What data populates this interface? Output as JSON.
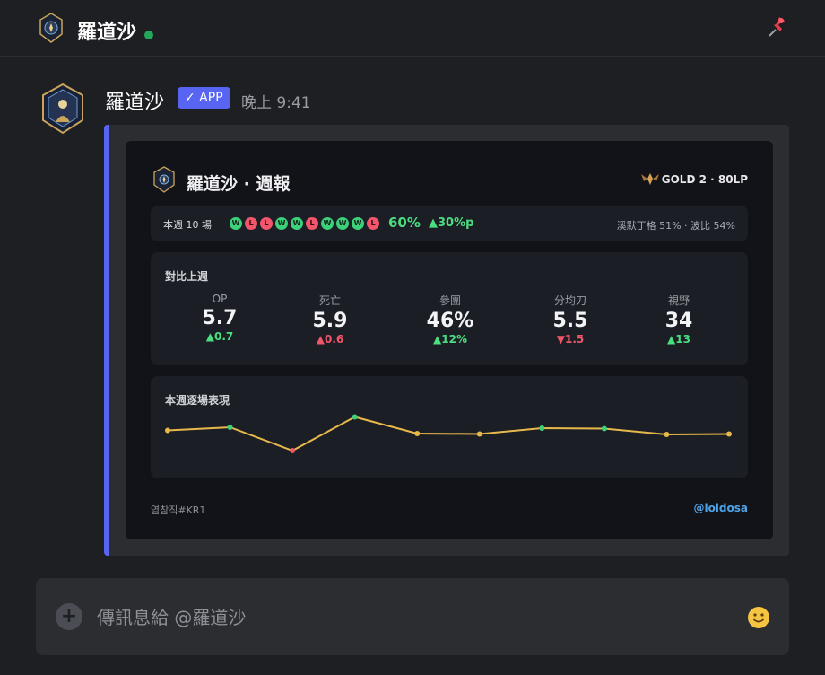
{
  "header": {
    "channel_name": "羅道沙",
    "status": "online"
  },
  "message": {
    "author": "羅道沙",
    "badge": "✓ APP",
    "time": "晚上 9:41"
  },
  "card": {
    "title": "羅道沙 · 週報",
    "rank": "GOLD 2 · 80LP",
    "week": {
      "label": "本週 10 場",
      "results": [
        "W",
        "L",
        "L",
        "W",
        "W",
        "L",
        "W",
        "W",
        "W",
        "L"
      ],
      "winrate": "60%",
      "winrate_delta": "▲30%p",
      "champions": "溪默丁格 51% · 波比 54%"
    },
    "comparison": {
      "title": "對比上週",
      "stats": [
        {
          "label": "OP",
          "value": "5.7",
          "delta": "▲0.7",
          "direction": "up"
        },
        {
          "label": "死亡",
          "value": "5.9",
          "delta": "▲0.6",
          "direction": "down"
        },
        {
          "label": "參團",
          "value": "46%",
          "delta": "▲12%",
          "direction": "up"
        },
        {
          "label": "分均刀",
          "value": "5.5",
          "delta": "▼1.5",
          "direction": "down"
        },
        {
          "label": "視野",
          "value": "34",
          "delta": "▲13",
          "direction": "up"
        }
      ]
    },
    "performance": {
      "title": "本週逐場表現"
    },
    "footer_left": "염참직#KR1",
    "footer_right": "@loldosa"
  },
  "chart_data": {
    "type": "line",
    "title": "本週逐場表現",
    "x": [
      1,
      2,
      3,
      4,
      5,
      6,
      7,
      8,
      9,
      10
    ],
    "values": [
      0.55,
      0.62,
      0.1,
      0.85,
      0.48,
      0.47,
      0.6,
      0.59,
      0.46,
      0.47
    ],
    "results": [
      "W",
      "W",
      "L",
      "W",
      "W",
      "L",
      "W",
      "W",
      "W",
      "L"
    ],
    "point_colors": [
      "#e8b94a",
      "#3dd07a",
      "#f2566b",
      "#3dd07a",
      "#e8b94a",
      "#e8b94a",
      "#3dd07a",
      "#3dd07a",
      "#e8b94a",
      "#e8b94a"
    ],
    "line_color": "#e8b94a",
    "grid": false
  },
  "composer": {
    "placeholder": "傳訊息給 @羅道沙"
  },
  "colors": {
    "accent": "#5865f2",
    "win": "#3dd07a",
    "loss": "#f2566b",
    "link": "#4ea3e8"
  }
}
